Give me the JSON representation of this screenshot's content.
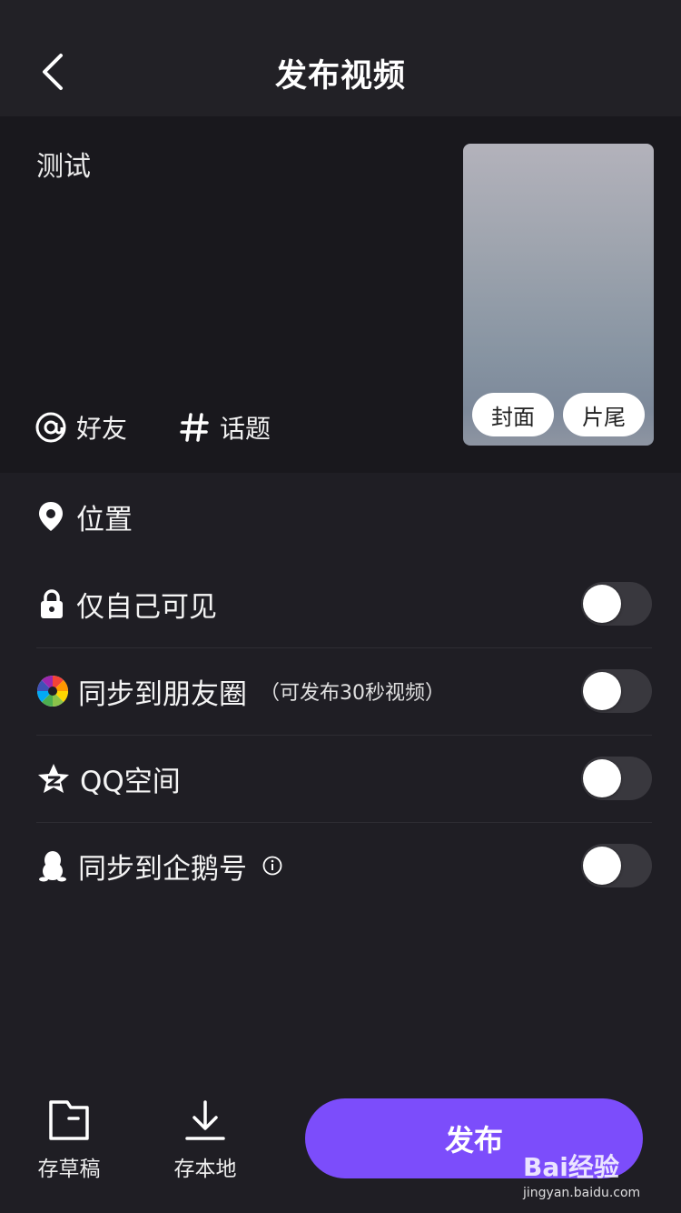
{
  "header": {
    "title": "发布视频"
  },
  "compose": {
    "description": "测试",
    "mention_label": "好友",
    "topic_label": "话题",
    "cover_label": "封面",
    "ending_label": "片尾"
  },
  "settings": {
    "location_label": "位置",
    "rows": [
      {
        "label": "仅自己可见",
        "sub": "",
        "icon": "lock-icon",
        "enabled": false
      },
      {
        "label": "同步到朋友圈",
        "sub": "（可发布30秒视频）",
        "icon": "wechat-moments-icon",
        "enabled": false
      },
      {
        "label": "QQ空间",
        "sub": "",
        "icon": "qzone-icon",
        "enabled": false
      },
      {
        "label": "同步到企鹅号",
        "sub": "",
        "icon": "penguin-icon",
        "enabled": false
      }
    ]
  },
  "bottom": {
    "draft_label": "存草稿",
    "save_local_label": "存本地",
    "publish_label": "发布"
  },
  "watermark": {
    "logo_text": "Bai经验",
    "url": "jingyan.baidu.com"
  },
  "colors": {
    "accent": "#7c4dfb",
    "background": "#1f1e24"
  }
}
